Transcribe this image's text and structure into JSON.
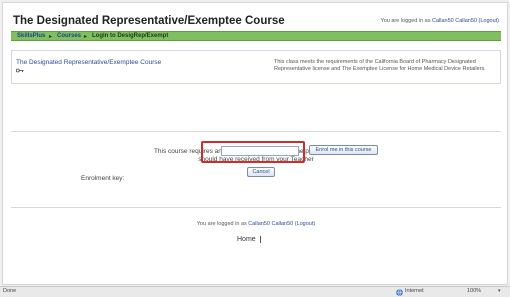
{
  "header": {
    "course_title": "The Designated Representative/Exemptee Course",
    "login_prefix": "You are logged in as ",
    "login_user": "Callan50 Callan50",
    "logout": "(Logout)"
  },
  "nav": {
    "items": [
      "SkillsPlus",
      "Courses",
      "Login to DesigRep/Exempt"
    ],
    "separators": [
      "▸",
      "▸"
    ]
  },
  "course_info": {
    "name": "The Designated Representative/Exemptee Course",
    "description": "This class meets the requirements of the California Board of Pharmacy Designated Representative license and The Exemptee License for Home Medical Device Retailers.",
    "icon": "key-icon"
  },
  "enrolment": {
    "message": "This course requires an 'enrolment key' - a one-time password that you should have received from your Teacher",
    "label": "Enrolment key:",
    "input_value": "",
    "enrol_button": "Enrol me in this course",
    "cancel_button": "Cancel",
    "highlight_color": "#c8302b"
  },
  "footer": {
    "login_prefix": "You are logged in as ",
    "login_user": "Callan50 Callan50",
    "logout": "(Logout)",
    "home": "Home"
  },
  "statusbar": {
    "status": "Done",
    "zone": "Internet",
    "zoom": "100%",
    "zone_icon": "globe-icon"
  },
  "colors": {
    "nav_bg": "#7fbf5f",
    "link": "#2a4e93"
  }
}
